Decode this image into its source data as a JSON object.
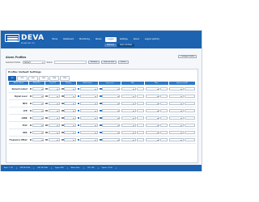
{
  "brand": {
    "name": "DEVA",
    "tagline": "BROADCAST LTD."
  },
  "nav": {
    "items": [
      "Home",
      "Dashboard",
      "Monitoring",
      "Stereo",
      "Logger",
      "Settings",
      "About",
      "Logout (admin)"
    ],
    "active_index": 4
  },
  "sub_nav": {
    "items": [
      "Channel",
      "Alarm Profiles"
    ],
    "active_index": 1
  },
  "alarm_profiles": {
    "title": "Alarm Profiles",
    "selected_profile_label": "Selected Profile:",
    "selected_profile_value": "Default",
    "name_label": "Name:",
    "name_value": "",
    "button_rename": "Rename",
    "button_save_as_new": "Save as new",
    "button_delete": "Delete",
    "button_configure": "Configure Profile"
  },
  "profile_settings": {
    "title": "Profile: Default Settings",
    "tabs": [
      "All",
      "FM1",
      "FM2",
      "FM3",
      "FM4",
      "FM5"
    ],
    "active_tab": 0,
    "columns": [
      "Alarm Name",
      "Main/Sec",
      "Trim/Tilt",
      "Display",
      "Notification",
      "Log event",
      "Min",
      "Max",
      "Hysteresis/dB"
    ],
    "rows": [
      {
        "name": "Demod Locked"
      },
      {
        "name": "Signal Level"
      },
      {
        "name": "MPX"
      },
      {
        "name": "LPR"
      },
      {
        "name": "LRDR"
      },
      {
        "name": "Pilot"
      },
      {
        "name": "RDS"
      },
      {
        "name": "Frequency Offset"
      }
    ],
    "select_placeholder": "Default"
  },
  "status_bar": {
    "items": [
      "Rack: 1 - RF",
      "FM1 98.0 MHz",
      "FM2 96.0 MHz",
      "Signal: RDS",
      "Alarm: None",
      "CPU: 18%",
      "Uptime: 12:34"
    ]
  },
  "colors": {
    "header_bg": "#1d63b0",
    "accent": "#2f79c7",
    "page_bg": "#f5f7fa"
  }
}
